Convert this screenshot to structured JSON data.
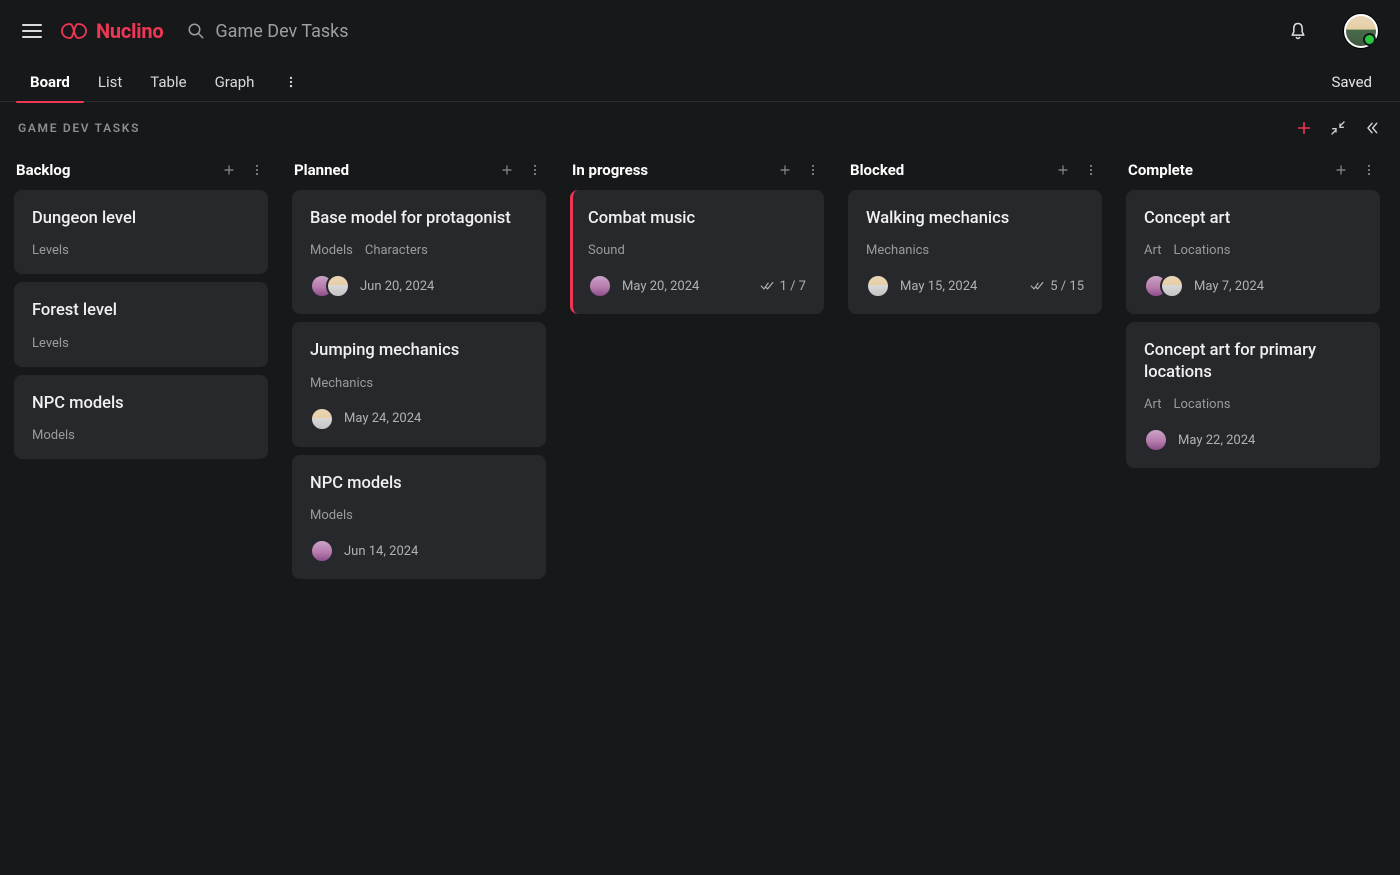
{
  "header": {
    "brand": "Nuclino",
    "search_placeholder": "Game Dev Tasks"
  },
  "views": {
    "tabs": [
      "Board",
      "List",
      "Table",
      "Graph"
    ],
    "active": "Board",
    "status": "Saved"
  },
  "breadcrumb": "GAME DEV TASKS",
  "columns": [
    {
      "name": "Backlog",
      "cards": [
        {
          "title": "Dungeon level",
          "tags": [
            "Levels"
          ],
          "avatars": [],
          "date": "",
          "check": "",
          "accent": false
        },
        {
          "title": "Forest level",
          "tags": [
            "Levels"
          ],
          "avatars": [],
          "date": "",
          "check": "",
          "accent": false
        },
        {
          "title": "NPC models",
          "tags": [
            "Models"
          ],
          "avatars": [],
          "date": "",
          "check": "",
          "accent": false
        }
      ]
    },
    {
      "name": "Planned",
      "cards": [
        {
          "title": "Base model for protagonist",
          "tags": [
            "Models",
            "Characters"
          ],
          "avatars": [
            "f",
            "m"
          ],
          "date": "Jun 20, 2024",
          "check": "",
          "accent": false
        },
        {
          "title": "Jumping mechanics",
          "tags": [
            "Mechanics"
          ],
          "avatars": [
            "m"
          ],
          "date": "May 24, 2024",
          "check": "",
          "accent": false
        },
        {
          "title": "NPC models",
          "tags": [
            "Models"
          ],
          "avatars": [
            "f"
          ],
          "date": "Jun 14, 2024",
          "check": "",
          "accent": false
        }
      ]
    },
    {
      "name": "In progress",
      "cards": [
        {
          "title": "Combat music",
          "tags": [
            "Sound"
          ],
          "avatars": [
            "f"
          ],
          "date": "May 20, 2024",
          "check": "1 / 7",
          "accent": true
        }
      ]
    },
    {
      "name": "Blocked",
      "cards": [
        {
          "title": "Walking mechanics",
          "tags": [
            "Mechanics"
          ],
          "avatars": [
            "m"
          ],
          "date": "May 15, 2024",
          "check": "5 / 15",
          "accent": false
        }
      ]
    },
    {
      "name": "Complete",
      "cards": [
        {
          "title": "Concept art",
          "tags": [
            "Art",
            "Locations"
          ],
          "avatars": [
            "f",
            "m"
          ],
          "date": "May 7, 2024",
          "check": "",
          "accent": false
        },
        {
          "title": "Concept art for primary locations",
          "tags": [
            "Art",
            "Locations"
          ],
          "avatars": [
            "f"
          ],
          "date": "May 22, 2024",
          "check": "",
          "accent": false
        }
      ]
    }
  ]
}
